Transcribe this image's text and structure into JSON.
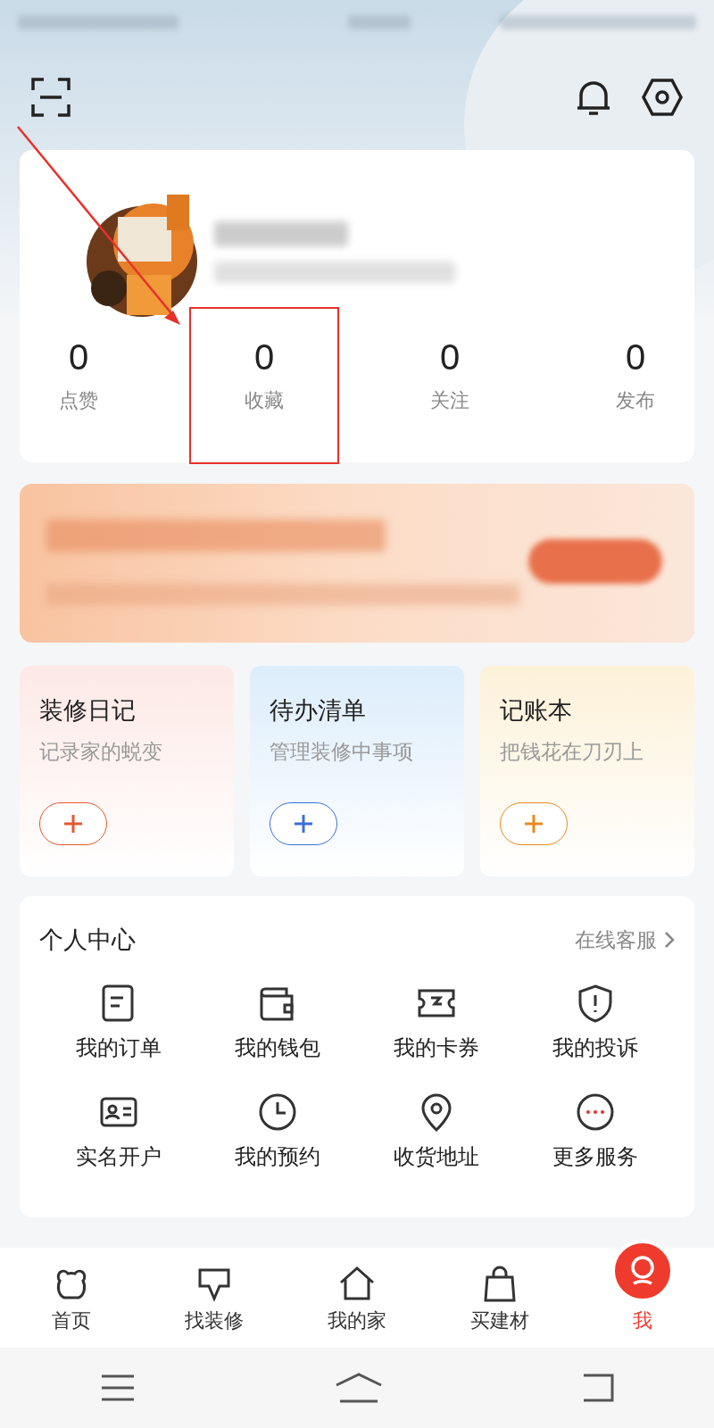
{
  "profile": {
    "stats": [
      {
        "value": "0",
        "label": "点赞",
        "highlighted": false
      },
      {
        "value": "0",
        "label": "收藏",
        "highlighted": true
      },
      {
        "value": "0",
        "label": "关注",
        "highlighted": false
      },
      {
        "value": "0",
        "label": "发布",
        "highlighted": false
      }
    ]
  },
  "tools": [
    {
      "title": "装修日记",
      "subtitle": "记录家的蜕变",
      "color": "#e4572e"
    },
    {
      "title": "待办清单",
      "subtitle": "管理装修中事项",
      "color": "#3b6fd8"
    },
    {
      "title": "记账本",
      "subtitle": "把钱花在刀刃上",
      "color": "#e8891c"
    }
  ],
  "personal_center": {
    "title": "个人中心",
    "link": "在线客服",
    "items": [
      {
        "label": "我的订单"
      },
      {
        "label": "我的钱包"
      },
      {
        "label": "我的卡券"
      },
      {
        "label": "我的投诉"
      },
      {
        "label": "实名开户"
      },
      {
        "label": "我的预约"
      },
      {
        "label": "收货地址"
      },
      {
        "label": "更多服务"
      }
    ]
  },
  "tab_bar": [
    {
      "label": "首页",
      "selected": false
    },
    {
      "label": "找装修",
      "selected": false
    },
    {
      "label": "我的家",
      "selected": false
    },
    {
      "label": "买建材",
      "selected": false
    },
    {
      "label": "我",
      "selected": true
    }
  ]
}
